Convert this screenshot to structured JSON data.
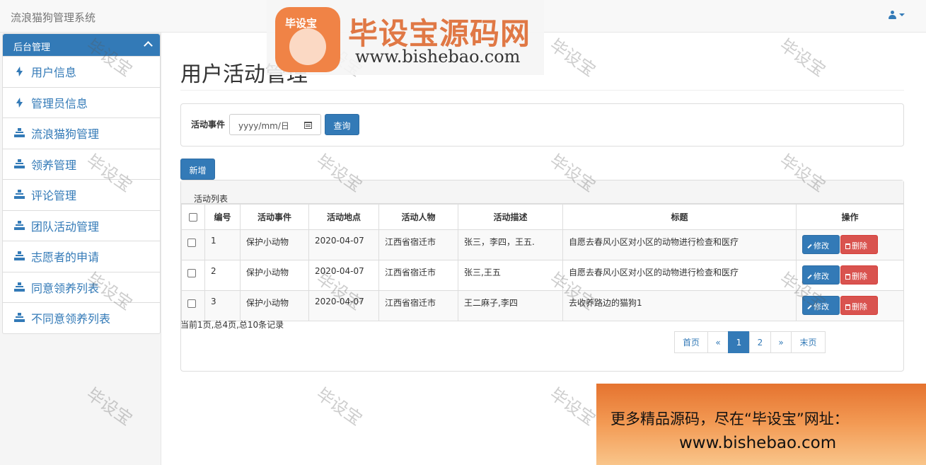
{
  "app": {
    "title": "流浪猫狗管理系统"
  },
  "sidebar": {
    "header": "后台管理",
    "items": [
      {
        "label": "用户信息",
        "icon": "bolt-icon"
      },
      {
        "label": "管理员信息",
        "icon": "bolt-icon"
      },
      {
        "label": "流浪猫狗管理",
        "icon": "sitemap-icon"
      },
      {
        "label": "领养管理",
        "icon": "sitemap-icon"
      },
      {
        "label": "评论管理",
        "icon": "sitemap-icon"
      },
      {
        "label": "团队活动管理",
        "icon": "sitemap-icon"
      },
      {
        "label": "志愿者的申请",
        "icon": "sitemap-icon"
      },
      {
        "label": "同意领养列表",
        "icon": "sitemap-icon"
      },
      {
        "label": "不同意领养列表",
        "icon": "sitemap-icon"
      }
    ]
  },
  "page": {
    "title": "用户活动管理"
  },
  "search": {
    "label": "活动事件",
    "date_placeholder": "yyyy/mm/日",
    "query_label": "查询"
  },
  "toolbar": {
    "add_label": "新增"
  },
  "list": {
    "heading": "活动列表",
    "columns": [
      "编号",
      "活动事件",
      "活动地点",
      "活动人物",
      "活动描述",
      "标题",
      "操作"
    ],
    "rows": [
      {
        "id": "1",
        "event": "保护小动物",
        "place": "2020-04-07",
        "people": "江西省宿迁市",
        "desc": "张三，李四，王五.",
        "title": "自愿去春风小区对小区的动物进行检查和医疗"
      },
      {
        "id": "2",
        "event": "保护小动物",
        "place": "2020-04-07",
        "people": "江西省宿迁市",
        "desc": "张三,王五",
        "title": "自愿去春风小区对小区的动物进行检查和医疗"
      },
      {
        "id": "3",
        "event": "保护小动物",
        "place": "2020-04-07",
        "people": "江西省宿迁市",
        "desc": "王二麻子,李四",
        "title": "去收养路边的猫狗1"
      }
    ],
    "edit_label": "修改",
    "delete_label": "删除",
    "summary": "当前1页,总4页,总10条记录"
  },
  "pager": {
    "first": "首页",
    "prev": "«",
    "pages": [
      "1",
      "2"
    ],
    "current": "1",
    "next": "»",
    "last": "末页"
  },
  "watermarks": {
    "text": "毕设宝"
  },
  "logo": {
    "badge": "毕设宝",
    "title": "毕设宝源码网",
    "url": "www.bishebao.com"
  },
  "promo": {
    "line1": "更多精品源码，尽在“毕设宝”网址：",
    "line2": "www.bishebao.com"
  },
  "colors": {
    "primary": "#337ab7",
    "danger": "#d9534f",
    "promo_top": "#e5732f",
    "logo_orange": "#e07845"
  }
}
